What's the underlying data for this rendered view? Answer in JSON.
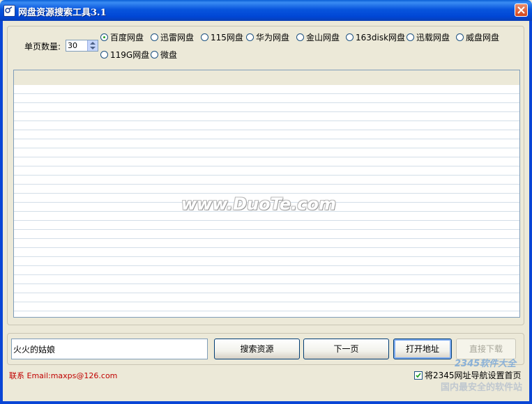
{
  "window": {
    "title": "网盘资源搜索工具3.1",
    "icon": "app-icon",
    "close_icon": "close-icon"
  },
  "options": {
    "page_count_label": "单页数量:",
    "page_count_value": "30",
    "selected_source": "百度网盘",
    "sources": [
      "百度网盘",
      "迅雷网盘",
      "115网盘",
      "华为网盘",
      "金山网盘",
      "163disk网盘",
      "迅载网盘",
      "威盘网盘",
      "119G网盘",
      "微盘"
    ]
  },
  "results": {
    "columns": [],
    "rows": [],
    "watermark": "www.DuoTe.com"
  },
  "search": {
    "value": "火火的姑娘"
  },
  "buttons": {
    "search": "搜索资源",
    "next_page": "下一页",
    "open_address": "打开地址",
    "direct_download": "直接下载"
  },
  "footer": {
    "contact": "联系 Email:maxps@126.com",
    "homepage_checkbox": "将2345网址导航设置首页",
    "homepage_checked": true,
    "logo": "2345软件大全",
    "logo_sub": "国内最安全的软件站"
  },
  "colors": {
    "titlebar": "#0855dd",
    "window_bg": "#ece9d8",
    "contact_text": "#c00000",
    "radio_selected": "#21a121"
  }
}
